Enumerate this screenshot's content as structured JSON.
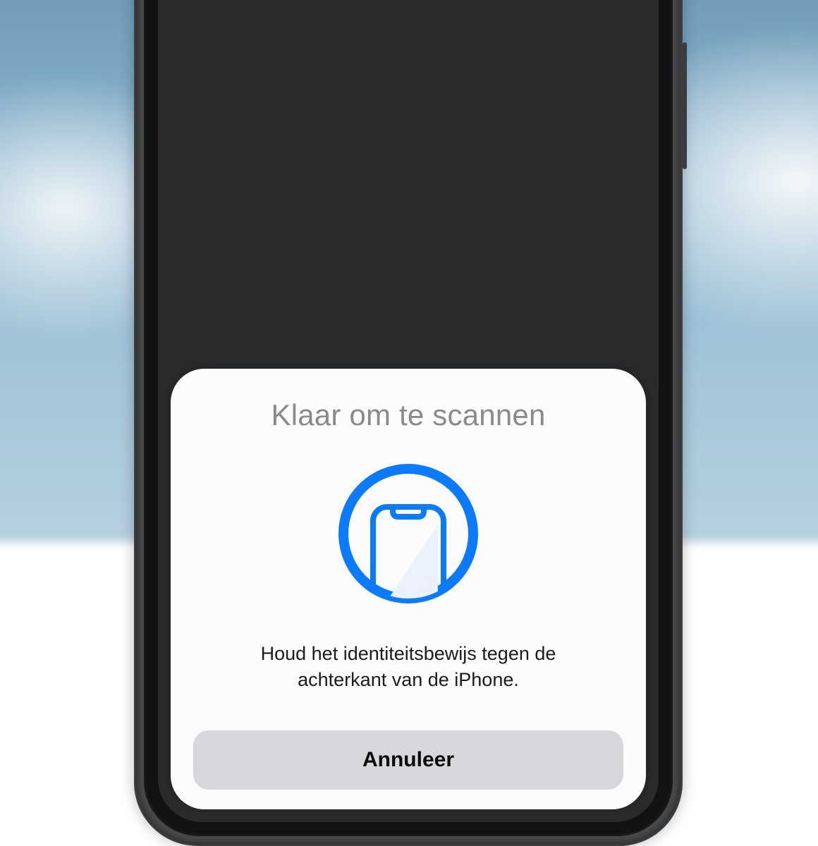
{
  "sheet": {
    "title": "Klaar om te scannen",
    "instruction": "Houd het identiteitsbewijs tegen de achterkant van de iPhone.",
    "cancel_label": "Annuleer"
  },
  "icons": {
    "nfc_phone": "nfc-phone-icon"
  },
  "colors": {
    "accent": "#0a7aff",
    "sheet_bg": "#fcfcfd",
    "title_muted": "#888a8d",
    "cancel_bg": "#d7d7dc"
  }
}
